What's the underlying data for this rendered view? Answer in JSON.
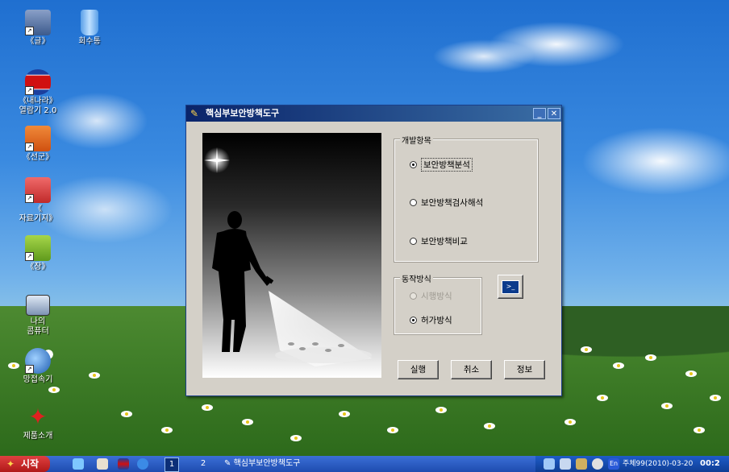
{
  "desktop": {
    "icons": [
      {
        "label": "《글》",
        "icon": "document-app-icon"
      },
      {
        "label": "회수통",
        "icon": "recycle-bin-icon"
      },
      {
        "label": "《내나라》\n열람기 2.0",
        "icon": "browser-flag-icon"
      },
      {
        "label": "《선군》",
        "icon": "presentation-app-icon"
      },
      {
        "label": "《\n자료기지》",
        "icon": "database-app-icon"
      },
      {
        "label": "《장》",
        "icon": "spreadsheet-app-icon"
      },
      {
        "label": "나의\n콤퓨터",
        "icon": "my-computer-icon"
      },
      {
        "label": "망접속기",
        "icon": "network-connect-icon"
      },
      {
        "label": "제품소개",
        "icon": "product-intro-icon"
      }
    ]
  },
  "window": {
    "title": "핵심부보안방책도구",
    "minimize_label": "_",
    "close_label": "✕",
    "development_group": {
      "title": "개발항목",
      "options": [
        {
          "label": "보안방책분석",
          "checked": true
        },
        {
          "label": "보안방책검사해석",
          "checked": false
        },
        {
          "label": "보안방책비교",
          "checked": false
        }
      ]
    },
    "operation_group": {
      "title": "동작방식",
      "options": [
        {
          "label": "시행방식",
          "checked": false,
          "disabled": true
        },
        {
          "label": "허가방식",
          "checked": true,
          "disabled": false
        }
      ]
    },
    "command_button_icon": "terminal-icon",
    "buttons": {
      "run": "실행",
      "cancel": "취소",
      "info": "정보"
    }
  },
  "taskbar": {
    "start_label": "시작",
    "pages": [
      "1",
      "2"
    ],
    "active_task": "핵심부보안방책도구",
    "tray_lang": "En",
    "date_text": "주체99(2010)-03-20",
    "time_text": "00:2"
  },
  "colors": {
    "title_bar": "#0a246a",
    "window_face": "#d4d0c8",
    "taskbar": "#1e4cb0",
    "start_button": "#c02020"
  }
}
